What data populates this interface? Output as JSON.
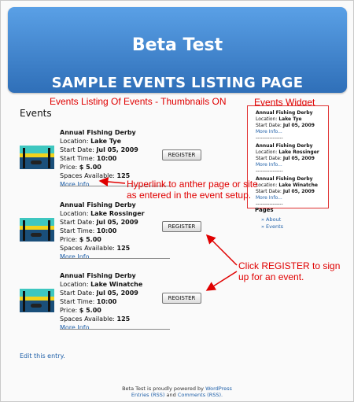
{
  "site": {
    "title": "Beta Test",
    "banner": "SAMPLE EVENTS LISTING PAGE"
  },
  "annotations": {
    "thumbs": "Events Listing Of Events - Thumbnails ON",
    "widget": "Events Widget",
    "hyperlink": "Hyperlink to anther page or site as entered in the event setup.",
    "register": "Click REGISTER to sign up for an event."
  },
  "page": {
    "heading": "Events",
    "edit_link": "Edit this entry."
  },
  "events": [
    {
      "title": "Annual Fishing Derby",
      "location_label": "Location:",
      "location": "Lake Tye",
      "date_label": "Start Date:",
      "date": "Jul 05, 2009",
      "time_label": "Start Time:",
      "time": "10:00",
      "price_label": "Price:",
      "price": "$ 5.00",
      "spaces_label": "Spaces Available:",
      "spaces": "125",
      "more": "More Info...",
      "register": "REGISTER"
    },
    {
      "title": "Annual Fishing Derby",
      "location_label": "Location:",
      "location": "Lake Rossinger",
      "date_label": "Start Date:",
      "date": "Jul 05, 2009",
      "time_label": "Start Time:",
      "time": "10:00",
      "price_label": "Price:",
      "price": "$ 5.00",
      "spaces_label": "Spaces Available:",
      "spaces": "125",
      "more": "More Info...",
      "register": "REGISTER"
    },
    {
      "title": "Annual Fishing Derby",
      "location_label": "Location:",
      "location": "Lake Winatche",
      "date_label": "Start Date:",
      "date": "Jul 05, 2009",
      "time_label": "Start Time:",
      "time": "10:00",
      "price_label": "Price:",
      "price": "$ 5.00",
      "spaces_label": "Spaces Available:",
      "spaces": "125",
      "more": "More Info...",
      "register": "REGISTER"
    }
  ],
  "widget": {
    "items": [
      {
        "title": "Annual Fishing Derby",
        "location_label": "Location:",
        "location": "Lake Tye",
        "date_label": "Start Date:",
        "date": "Jul 05, 2009",
        "more": "More Info...",
        "sep": "----------------"
      },
      {
        "title": "Annual Fishing Derby",
        "location_label": "Location:",
        "location": "Lake Rossinger",
        "date_label": "Start Date:",
        "date": "Jul 05, 2009",
        "more": "More Info...",
        "sep": "----------------"
      },
      {
        "title": "Annual Fishing Derby",
        "location_label": "Location:",
        "location": "Lake Winatche",
        "date_label": "Start Date:",
        "date": "Jul 05, 2009",
        "more": "More Info...",
        "sep": "----------------"
      }
    ]
  },
  "sidebar_pages": {
    "heading": "Pages",
    "items": [
      "» About",
      "» Events"
    ]
  },
  "footer": {
    "line1_prefix": "Beta Test is proudly powered by",
    "line1_link": "WordPress",
    "entries": "Entries (RSS)",
    "and": "and",
    "comments": "Comments (RSS)."
  },
  "colors": {
    "header_top": "#5aa0e6",
    "header_bottom": "#2f6fb8",
    "annotation": "#e00000",
    "link": "#1e5fa8"
  }
}
